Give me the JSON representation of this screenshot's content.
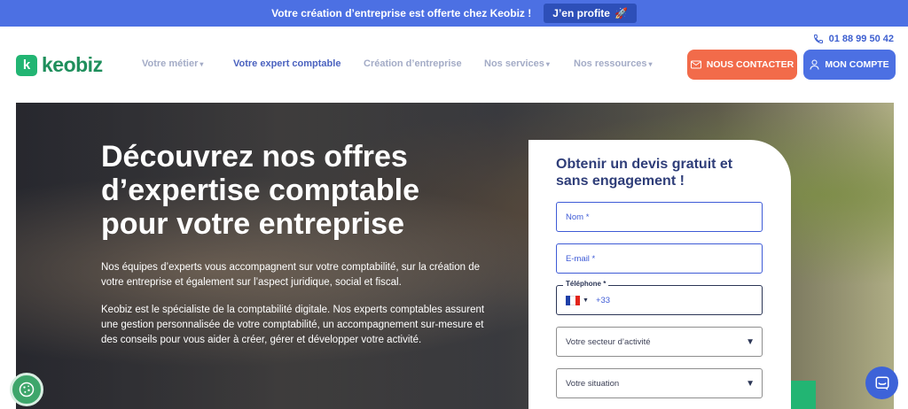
{
  "promo": {
    "text": "Votre création d’entreprise est offerte chez Keobiz !",
    "button_label": "J’en profite",
    "button_icon": "rocket-icon"
  },
  "header": {
    "phone": "01 88 99 50 42",
    "logo_text": "keobiz",
    "logo_mark": "k",
    "nav": [
      {
        "label": "Votre métier",
        "has_dropdown": true
      },
      {
        "label": "Votre expert comptable",
        "active": true
      },
      {
        "label": "Création d’entreprise"
      },
      {
        "label": "Nos services",
        "has_dropdown": true
      },
      {
        "label": "Nos ressources",
        "has_dropdown": true
      }
    ],
    "contact_label": "NOUS CONTACTER",
    "account_label": "MON COMPTE"
  },
  "hero": {
    "title": "Découvrez nos offres d’expertise comptable pour votre entreprise",
    "paragraph_1": "Nos équipes d’experts vous accompagnent sur votre comptabilité, sur la création de votre entreprise et également sur l’aspect juridique, social et fiscal.",
    "paragraph_2": "Keobiz est le spécialiste de la comptabilité digitale. Nos experts comptables assurent une gestion personnalisée de votre comptabilité, un accompagnement sur-mesure et des conseils pour vous aider à créer, gérer et développer votre activité."
  },
  "form": {
    "title": "Obtenir un devis gratuit et sans engagement !",
    "name_placeholder": "Nom *",
    "email_placeholder": "E-mail *",
    "phone_label": "Téléphone *",
    "phone_code": "+33",
    "sector_label": "Votre secteur d’activité",
    "situation_label": "Votre situation"
  },
  "colors": {
    "primary": "#4c70e3",
    "accent": "#f26b4a",
    "brand_green": "#22b573",
    "form_title": "#2f3e79"
  }
}
